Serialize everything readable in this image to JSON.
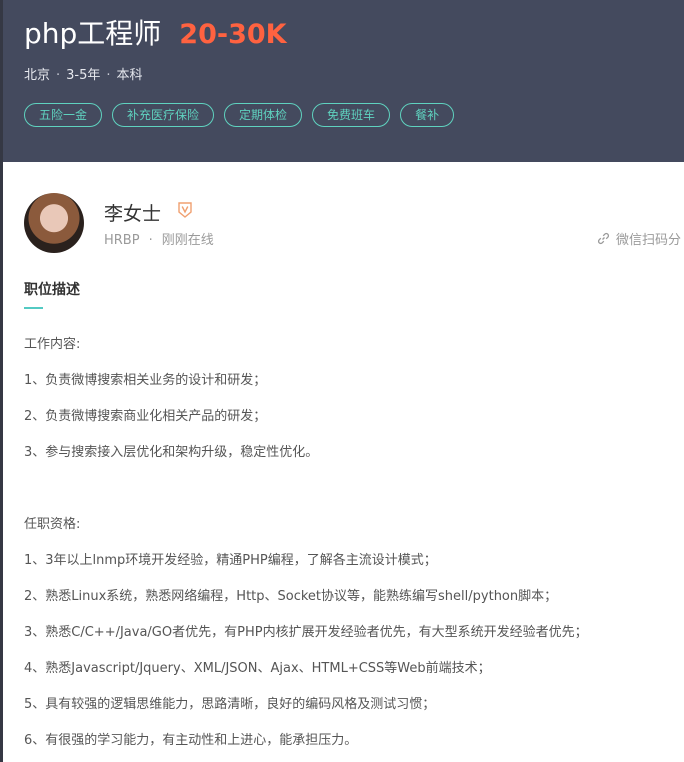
{
  "job": {
    "title": "php工程师",
    "salary": "20-30K",
    "location": "北京",
    "experience": "3-5年",
    "education": "本科",
    "tags": [
      "五险一金",
      "补充医疗保险",
      "定期体检",
      "免费班车",
      "餐补"
    ]
  },
  "recruiter": {
    "name": "李女士",
    "role": "HRBP",
    "status": "刚刚在线",
    "share_label": "微信扫码分"
  },
  "section": {
    "title": "职位描述"
  },
  "description": {
    "duties_heading": "工作内容:",
    "duties": [
      "1、负责微博搜索相关业务的设计和研发；",
      "2、负责微博搜索商业化相关产品的研发；",
      "3、参与搜索接入层优化和架构升级，稳定性优化。"
    ],
    "requirements_heading": "任职资格:",
    "requirements": [
      "1、3年以上lnmp环境开发经验，精通PHP编程，了解各主流设计模式；",
      "2、熟悉Linux系统，熟悉网络编程，Http、Socket协议等，能熟练编写shell/python脚本；",
      "3、熟悉C/C++/Java/GO者优先，有PHP内核扩展开发经验者优先，有大型系统开发经验者优先；",
      "4、熟悉Javascript/Jquery、XML/JSON、Ajax、HTML+CSS等Web前端技术；",
      "5、具有较强的逻辑思维能力，思路清晰，良好的编码风格及测试习惯；",
      "6、有很强的学习能力，有主动性和上进心，能承担压力。"
    ]
  },
  "colors": {
    "header_bg": "#444a5e",
    "salary": "#ff6240",
    "tag_accent": "#5fd2bf",
    "underline_accent": "#53cac3"
  }
}
